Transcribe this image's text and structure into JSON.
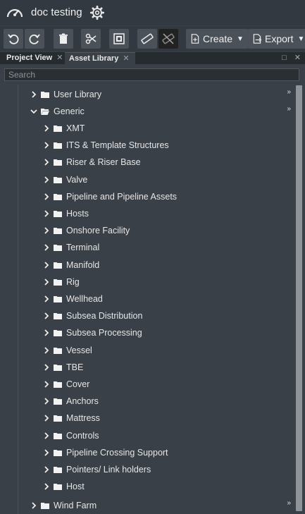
{
  "header": {
    "title": "doc testing"
  },
  "toolbar": {
    "create_label": "Create",
    "export_label": "Export"
  },
  "tabs": [
    {
      "label": "Project View",
      "close": "✕"
    },
    {
      "label": "Asset Library",
      "close": "✕"
    }
  ],
  "window_controls": {
    "maximize": "□",
    "close": "✕"
  },
  "search": {
    "placeholder": "Search"
  },
  "tree": {
    "user_library": "User Library",
    "generic": "Generic",
    "children": [
      "XMT",
      "ITS & Template Structures",
      "Riser & Riser Base",
      "Valve",
      "Pipeline and Pipeline Assets",
      "Hosts",
      "Onshore Facility",
      "Terminal",
      "Manifold",
      "Rig",
      "Wellhead",
      "Subsea Distribution",
      "Subsea Processing",
      "Vessel",
      "TBE",
      "Cover",
      "Anchors",
      "Mattress",
      "Controls",
      "Pipeline Crossing Support",
      "Pointers/ Link holders",
      "Host"
    ],
    "wind_farm": "Wind Farm"
  }
}
